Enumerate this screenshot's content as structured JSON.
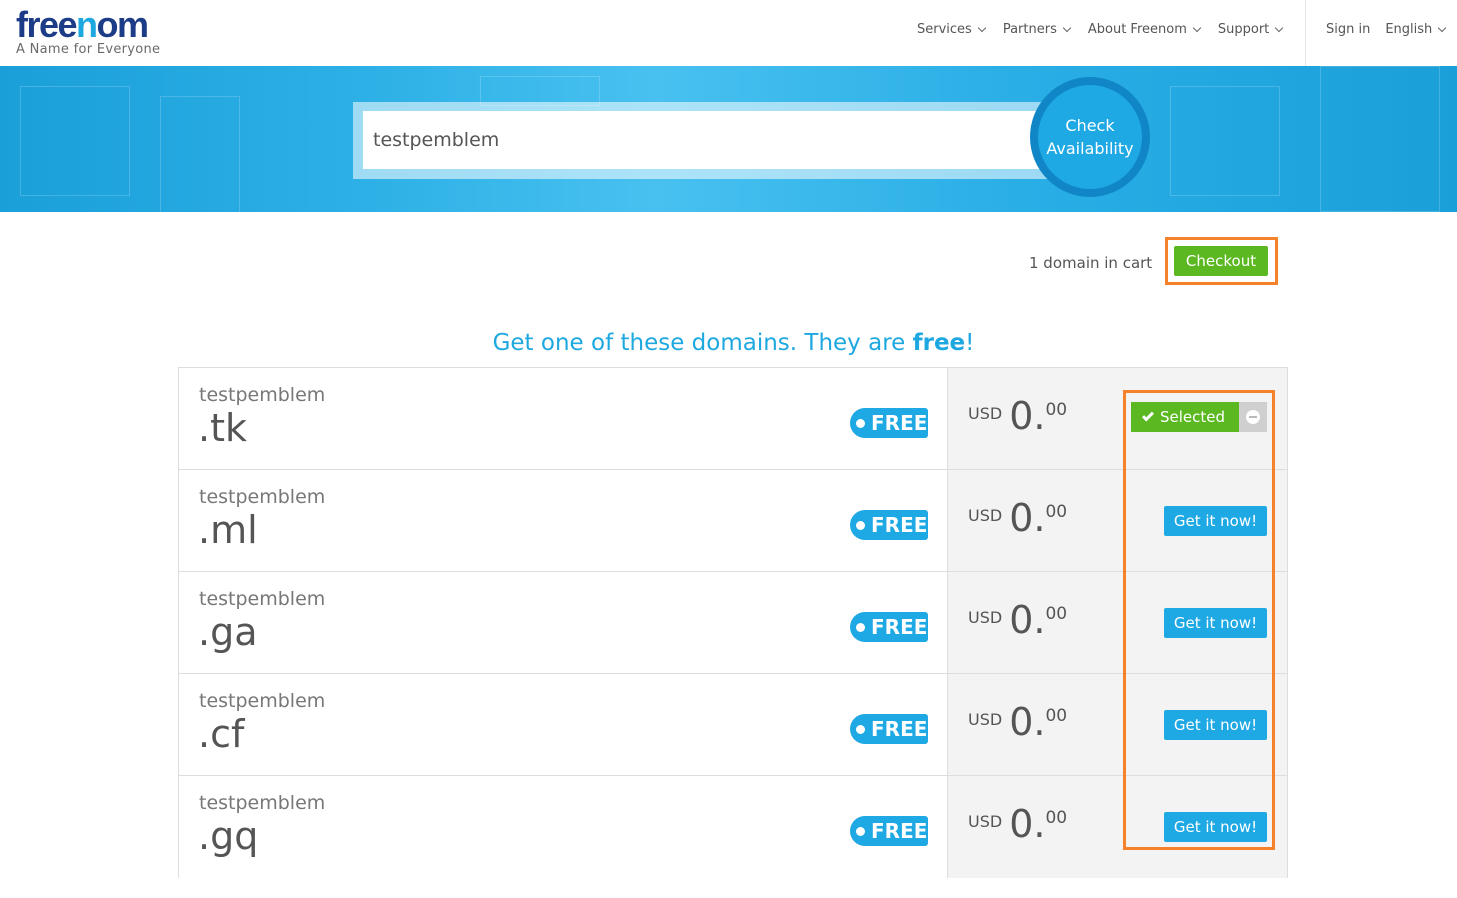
{
  "header": {
    "logo_text": "freenom",
    "tagline": "A Name for Everyone",
    "nav": [
      "Services",
      "Partners",
      "About Freenom",
      "Support"
    ],
    "sign_in": "Sign in",
    "language": "English"
  },
  "search": {
    "value": "testpemblem",
    "button_line1": "Check",
    "button_line2": "Availability"
  },
  "cart": {
    "text": "1 domain in cart",
    "checkout_label": "Checkout"
  },
  "section": {
    "title_prefix": "Get one of these domains. They are ",
    "title_bold": "free",
    "title_suffix": "!"
  },
  "domains": [
    {
      "name": "testpemblem",
      "tld": ".tk",
      "badge": "FREE",
      "currency": "USD",
      "price_int": "0.",
      "price_dec": "00",
      "status": "selected",
      "action_label": "Selected"
    },
    {
      "name": "testpemblem",
      "tld": ".ml",
      "badge": "FREE",
      "currency": "USD",
      "price_int": "0.",
      "price_dec": "00",
      "status": "available",
      "action_label": "Get it now!"
    },
    {
      "name": "testpemblem",
      "tld": ".ga",
      "badge": "FREE",
      "currency": "USD",
      "price_int": "0.",
      "price_dec": "00",
      "status": "available",
      "action_label": "Get it now!"
    },
    {
      "name": "testpemblem",
      "tld": ".cf",
      "badge": "FREE",
      "currency": "USD",
      "price_int": "0.",
      "price_dec": "00",
      "status": "available",
      "action_label": "Get it now!"
    },
    {
      "name": "testpemblem",
      "tld": ".gq",
      "badge": "FREE",
      "currency": "USD",
      "price_int": "0.",
      "price_dec": "00",
      "status": "available",
      "action_label": "Get it now!"
    }
  ],
  "colors": {
    "brand_blue": "#1ea8e0",
    "brand_navy": "#1d3c87",
    "success_green": "#5bb821",
    "highlight_orange": "#f5822a"
  }
}
